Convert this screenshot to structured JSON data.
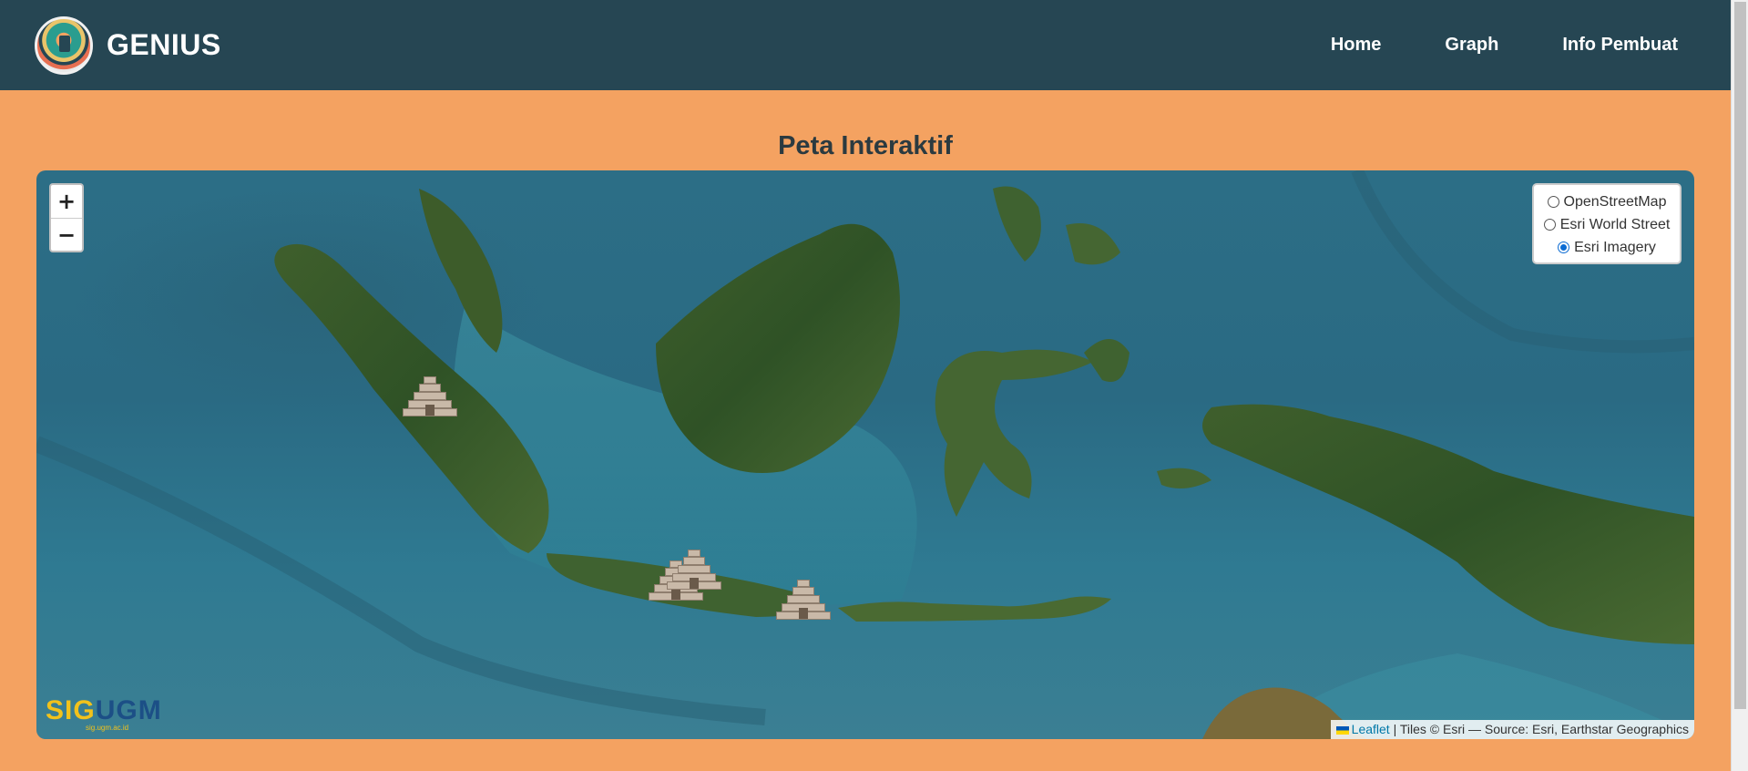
{
  "header": {
    "brand": "GENIUS",
    "logo_icon": "genius-logo",
    "nav": [
      {
        "label": "Home"
      },
      {
        "label": "Graph"
      },
      {
        "label": "Info Pembuat"
      }
    ],
    "background": "#264653"
  },
  "main": {
    "title": "Peta Interaktif",
    "background": "#f4a261"
  },
  "map": {
    "zoom_in": "+",
    "zoom_out": "−",
    "layers": [
      {
        "label": "OpenStreetMap",
        "checked": false
      },
      {
        "label": "Esri World Street",
        "checked": false
      },
      {
        "label": "Esri Imagery",
        "checked": true
      }
    ],
    "markers": [
      {
        "icon": "temple-marker-icon"
      },
      {
        "icon": "temple-marker-icon"
      },
      {
        "icon": "temple-marker-icon"
      },
      {
        "icon": "temple-marker-icon"
      }
    ],
    "watermark": {
      "part1": "SIG",
      "part2": "UGM",
      "sub": "sig.ugm.ac.id"
    },
    "attribution": {
      "link": "Leaflet",
      "text": " | Tiles © Esri — Source: Esri, Earthstar Geographics"
    }
  }
}
